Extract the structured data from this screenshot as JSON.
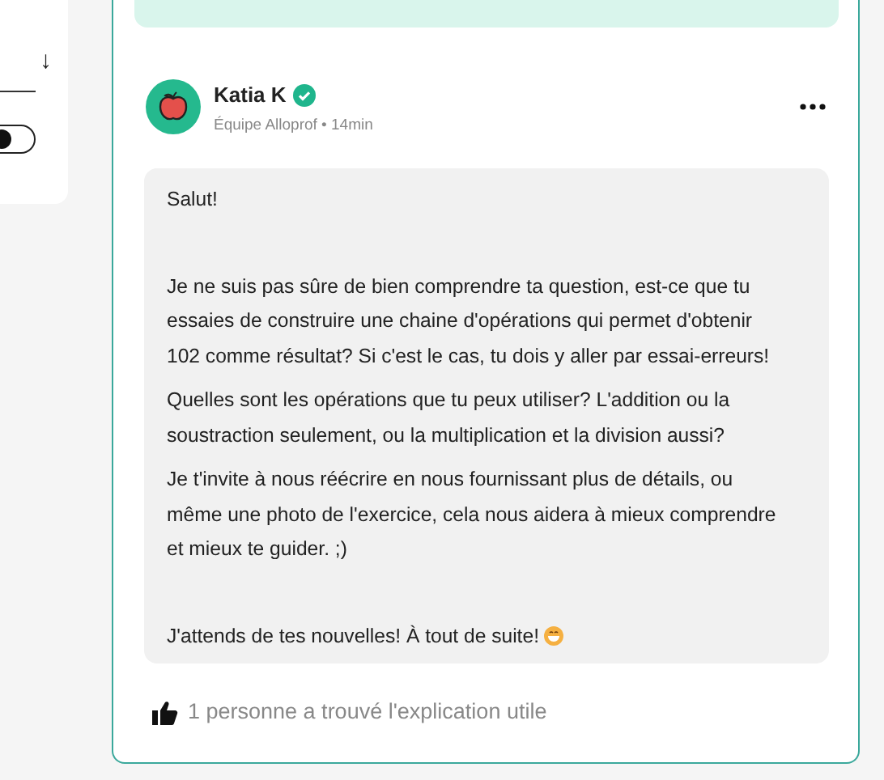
{
  "sidebar": {
    "sort_arrow": "↓",
    "toggle": {
      "on": false
    }
  },
  "answer": {
    "author": {
      "name": "Katia K",
      "verified": true,
      "team": "Équipe Alloprof",
      "separator": "•",
      "time": "14min"
    },
    "paragraphs": [
      {
        "text": "Salut!"
      },
      {
        "text": "Je ne suis pas sûre de bien comprendre ta question, est-ce que tu essaies de construire une chaine d'opérations qui permet d'obtenir 102 comme résultat? Si c'est le cas, tu dois y aller par essai-erreurs!"
      },
      {
        "text": "Quelles sont les opérations que tu peux utiliser? L'addition ou la soustraction seulement, ou la multiplication et la division aussi?"
      },
      {
        "text": "Je t'invite à nous réécrire en nous fournissant plus de détails, ou même une photo de l'exercice, cela nous aidera à mieux comprendre et mieux te guider. ;)"
      },
      {
        "text": "J'attends de tes nouvelles! À tout de suite!",
        "emoji": true
      }
    ],
    "helpful": "1 personne a trouvé l'explication utile"
  }
}
